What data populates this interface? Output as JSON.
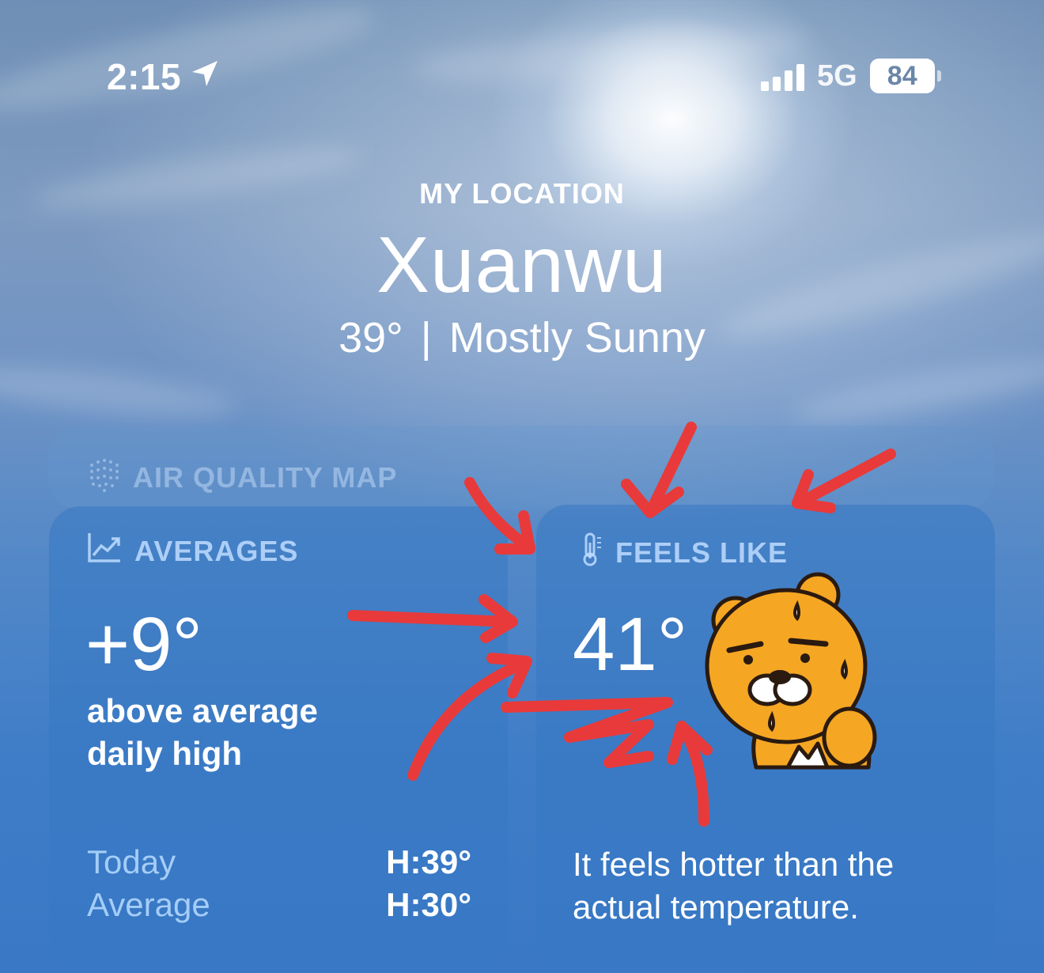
{
  "status_bar": {
    "time": "2:15",
    "location_icon": "location-arrow-icon",
    "network": "5G",
    "battery": "84"
  },
  "header": {
    "location_label": "MY LOCATION",
    "city": "Xuanwu",
    "temperature": "39°",
    "separator": "|",
    "condition": "Mostly Sunny"
  },
  "air_quality_map": {
    "label": "AIR QUALITY MAP",
    "icon": "dot-grid-icon"
  },
  "averages": {
    "label": "AVERAGES",
    "icon": "line-chart-icon",
    "value": "+9°",
    "caption_line1": "above average",
    "caption_line2": "daily high",
    "rows": [
      {
        "label": "Today",
        "value": "H:39°"
      },
      {
        "label": "Average",
        "value": "H:30°"
      }
    ]
  },
  "feels_like": {
    "label": "FEELS LIKE",
    "icon": "thermometer-icon",
    "value": "41°",
    "description_line1": "It feels hotter than the",
    "description_line2": "actual temperature.",
    "sticker": "sweating-bear-sticker"
  },
  "annotation_color": "#e83a3a"
}
